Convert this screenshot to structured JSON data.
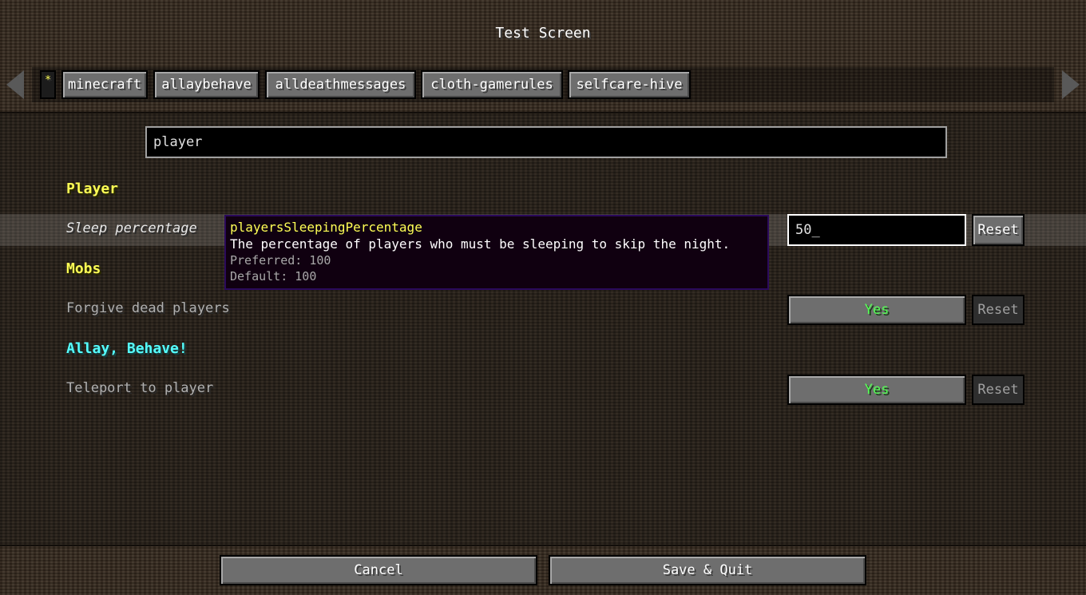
{
  "window": {
    "title": "Test Screen"
  },
  "tabs": {
    "items": [
      {
        "label": "*"
      },
      {
        "label": "minecraft"
      },
      {
        "label": "allaybehave"
      },
      {
        "label": "alldeathmessages"
      },
      {
        "label": "cloth-gamerules"
      },
      {
        "label": "selfcare-hive"
      }
    ],
    "selected_index": 0
  },
  "search": {
    "value": "player"
  },
  "categories": [
    {
      "title": "Player",
      "color": "#ffff55",
      "entries": [
        {
          "label": "Sleep percentage",
          "value": "50_",
          "reset_label": "Reset",
          "hovered": true
        }
      ]
    },
    {
      "title": "Mobs",
      "color": "#ffff55",
      "entries": [
        {
          "label": "Forgive dead players",
          "value": "Yes",
          "reset_label": "Reset",
          "value_color": "#55ff55"
        }
      ]
    },
    {
      "title": "Allay, Behave!",
      "color": "#55ffff",
      "entries": [
        {
          "label": "Teleport to player",
          "value": "Yes",
          "reset_label": "Reset",
          "value_color": "#55ff55"
        }
      ]
    }
  ],
  "tooltip": {
    "key": "playersSleepingPercentage",
    "description": "The percentage of players who must be sleeping to skip the night.",
    "preferred": "Preferred: 100",
    "default": "Default: 100"
  },
  "footer": {
    "cancel_label": "Cancel",
    "save_label": "Save & Quit"
  },
  "icons": {
    "left": "arrow-left-icon",
    "right": "arrow-right-icon"
  }
}
